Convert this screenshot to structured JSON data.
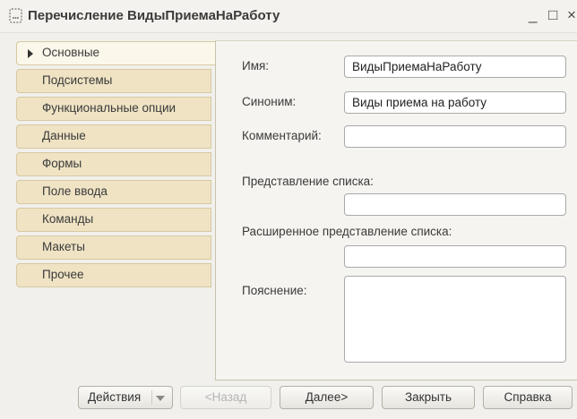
{
  "window": {
    "title": "Перечисление ВидыПриемаНаРаботу",
    "minimize_glyph": "_",
    "maximize_glyph": "□",
    "close_glyph": "×"
  },
  "tabs": [
    {
      "label": "Основные",
      "active": true
    },
    {
      "label": "Подсистемы",
      "active": false
    },
    {
      "label": "Функциональные опции",
      "active": false
    },
    {
      "label": "Данные",
      "active": false
    },
    {
      "label": "Формы",
      "active": false
    },
    {
      "label": "Поле ввода",
      "active": false
    },
    {
      "label": "Команды",
      "active": false
    },
    {
      "label": "Макеты",
      "active": false
    },
    {
      "label": "Прочее",
      "active": false
    }
  ],
  "form": {
    "name_label": "Имя:",
    "name_value": "ВидыПриемаНаРаботу",
    "synonym_label": "Синоним:",
    "synonym_value": "Виды приема на работу",
    "comment_label": "Комментарий:",
    "comment_value": "",
    "list_repr_label": "Представление списка:",
    "list_repr_value": "",
    "ext_list_repr_label": "Расширенное представление списка:",
    "ext_list_repr_value": "",
    "explanation_label": "Пояснение:",
    "explanation_value": ""
  },
  "footer": {
    "actions_label": "Действия",
    "back_label": "<Назад",
    "next_label": "Далее>",
    "close_label": "Закрыть",
    "help_label": "Справка"
  },
  "colors": {
    "tab_bg": "#efe3c4",
    "tab_active_bg": "#fbf7ea",
    "window_bg": "#f1f0ec"
  }
}
